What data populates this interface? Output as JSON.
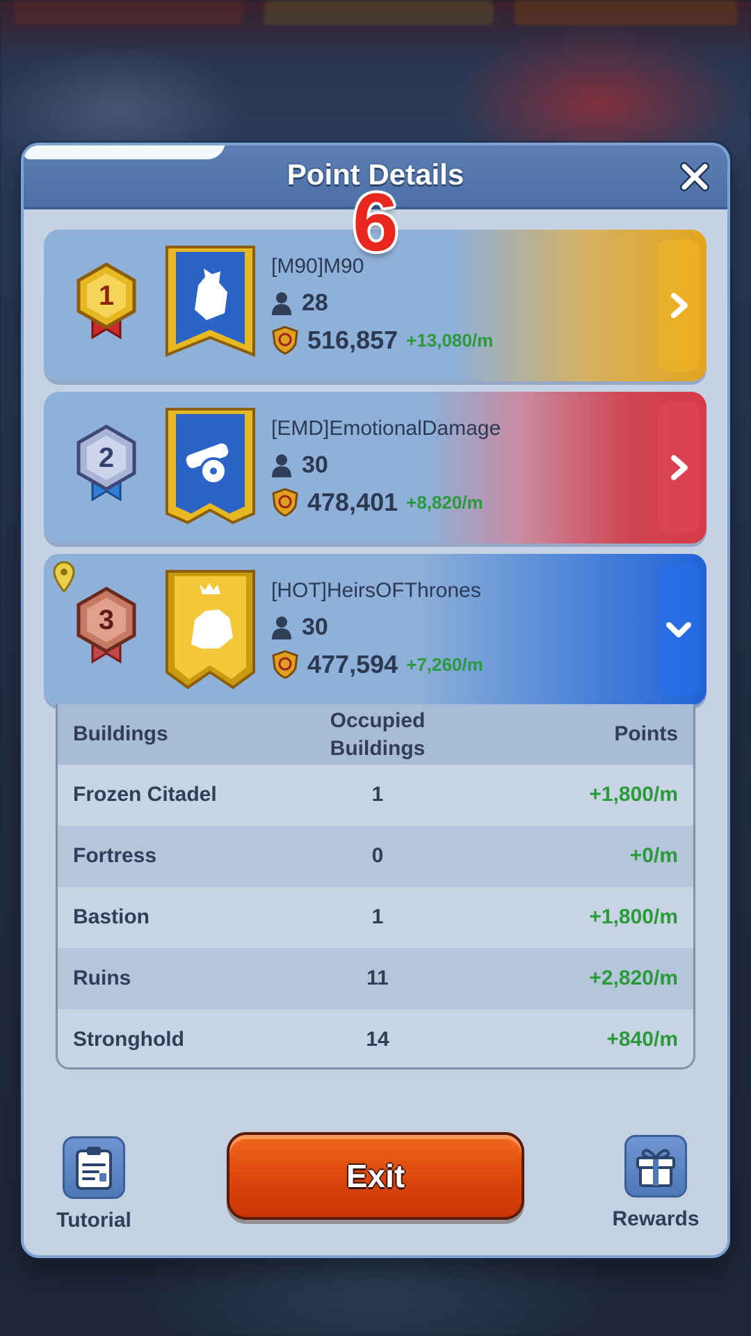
{
  "dialog": {
    "title": "Point Details",
    "overlay_number": "6"
  },
  "alliances": [
    {
      "rank": "1",
      "name": "[M90]M90",
      "members": "28",
      "points": "516,857",
      "rate": "+13,080/m",
      "accent": "#e3a51d",
      "expanded": false
    },
    {
      "rank": "2",
      "name": "[EMD]EmotionalDamage",
      "members": "30",
      "points": "478,401",
      "rate": "+8,820/m",
      "accent": "#d73a48",
      "expanded": false
    },
    {
      "rank": "3",
      "name": "[HOT]HeirsOFThrones",
      "members": "30",
      "points": "477,594",
      "rate": "+7,260/m",
      "accent": "#1f63d8",
      "expanded": true
    }
  ],
  "buildings_table": {
    "headers": {
      "building": "Buildings",
      "occupied_line1": "Occupied",
      "occupied_line2": "Buildings",
      "points": "Points"
    },
    "rows": [
      {
        "name": "Frozen Citadel",
        "count": "1",
        "points": "+1,800/m"
      },
      {
        "name": "Fortress",
        "count": "0",
        "points": "+0/m"
      },
      {
        "name": "Bastion",
        "count": "1",
        "points": "+1,800/m"
      },
      {
        "name": "Ruins",
        "count": "11",
        "points": "+2,820/m"
      },
      {
        "name": "Stronghold",
        "count": "14",
        "points": "+840/m"
      }
    ]
  },
  "footer": {
    "tutorial_label": "Tutorial",
    "exit_label": "Exit",
    "rewards_label": "Rewards"
  },
  "icons": {
    "close": "close-icon",
    "member": "person-icon",
    "points": "shield-points-icon",
    "tutorial": "clipboard-icon",
    "rewards": "gift-icon",
    "location": "location-pin-icon"
  },
  "colors": {
    "points_green": "#2b9a3a",
    "exit_orange": "#d9420a",
    "header_blue": "#4d70a6"
  }
}
